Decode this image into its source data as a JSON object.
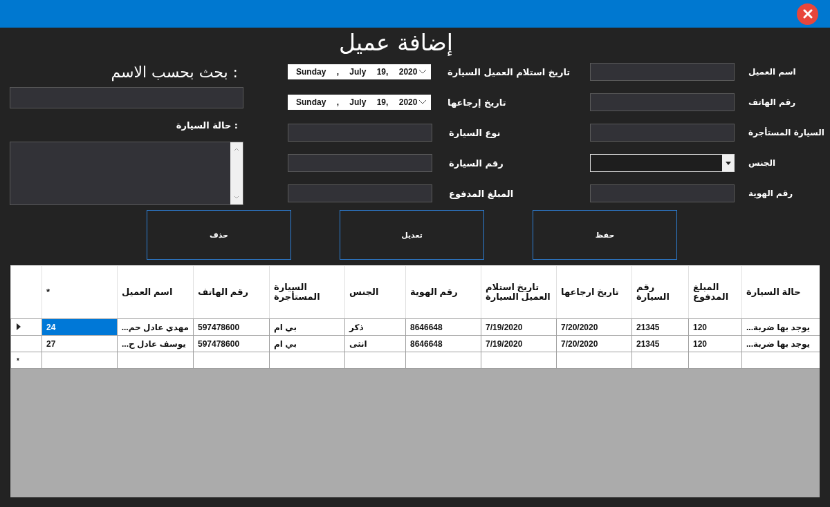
{
  "window": {
    "title": "إضافة عميل"
  },
  "search": {
    "title": "بحث بحسب الاسم :"
  },
  "car_status": {
    "label": "حالة السيارة :"
  },
  "middle_fields": [
    {
      "label": "تاريخ استلام العميل السيارة",
      "kind": "date",
      "value": "Sunday , July 19, 2020"
    },
    {
      "label": "تاريخ إرجاعها",
      "kind": "date",
      "value": "Sunday , July 19, 2020"
    },
    {
      "label": "نوع السيارة",
      "kind": "text"
    },
    {
      "label": "رقم السيارة",
      "kind": "text"
    },
    {
      "label": "المبلغ المدفوع",
      "kind": "text"
    }
  ],
  "right_fields": [
    {
      "label": "اسم العميل",
      "kind": "text"
    },
    {
      "label": "رقم الهاتف",
      "kind": "text"
    },
    {
      "label": "السيارة المستأجرة",
      "kind": "text"
    },
    {
      "label": "الجنس",
      "kind": "combo"
    },
    {
      "label": "رقم الهوية",
      "kind": "text"
    }
  ],
  "buttons": [
    "حفظ",
    "تعديل",
    "حذف"
  ],
  "table": {
    "columns": [
      "حالة السيارة",
      "المبلغ المدفوع",
      "رقم السيارة",
      "تاريخ ارجاعها",
      "تاريخ استلام العميل السيارة",
      "رقم الهوية",
      "الجنس",
      "السيارة المستأجرة",
      "رقم الهاتف",
      "اسم العميل",
      "*"
    ],
    "rows": [
      {
        "selected": true,
        "cells": [
          "يوجد بها ضربة...",
          "120",
          "21345",
          "7/20/2020",
          "7/19/2020",
          "8646648",
          "ذكر",
          "بي ام",
          "597478600",
          "مهدي عادل حم...",
          "24"
        ]
      },
      {
        "selected": false,
        "cells": [
          "يوجد بها ضربة...",
          "120",
          "21345",
          "7/20/2020",
          "7/19/2020",
          "8646648",
          "انثى",
          "بي ام",
          "597478600",
          "يوسف عادل ح...",
          "27"
        ]
      }
    ],
    "new_row_marker": "*"
  }
}
